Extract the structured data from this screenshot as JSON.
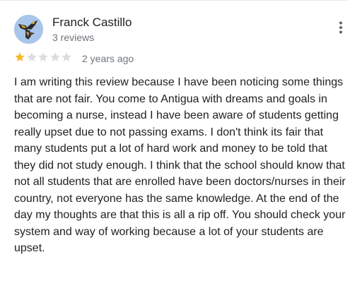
{
  "review": {
    "reviewer_name": "Franck Castillo",
    "review_count": "3 reviews",
    "avatar_icon": "bird-avatar-icon",
    "rating": 1,
    "rating_max": 5,
    "date": "2 years ago",
    "text": "I am writing this review because I have been noticing some things that are not fair. You come to Antigua with dreams and goals in becoming a nurse, instead I have been aware of students getting really upset due to not passing exams. I don't think its fair that many students put a lot of hard work and money to be told that they did not study enough. I think that the school should know that not all students that are enrolled have been doctors/nurses in their country, not everyone has the same knowledge. At the end of the day my thoughts are that this is all a rip off. You should check your system and way of working because a lot of your students are upset."
  },
  "menu": {
    "icon": "more-vertical-icon"
  },
  "colors": {
    "star_filled": "#f7b928",
    "star_empty": "#dadce0",
    "secondary_text": "#70757a",
    "avatar_background": "#a9c6ea"
  }
}
